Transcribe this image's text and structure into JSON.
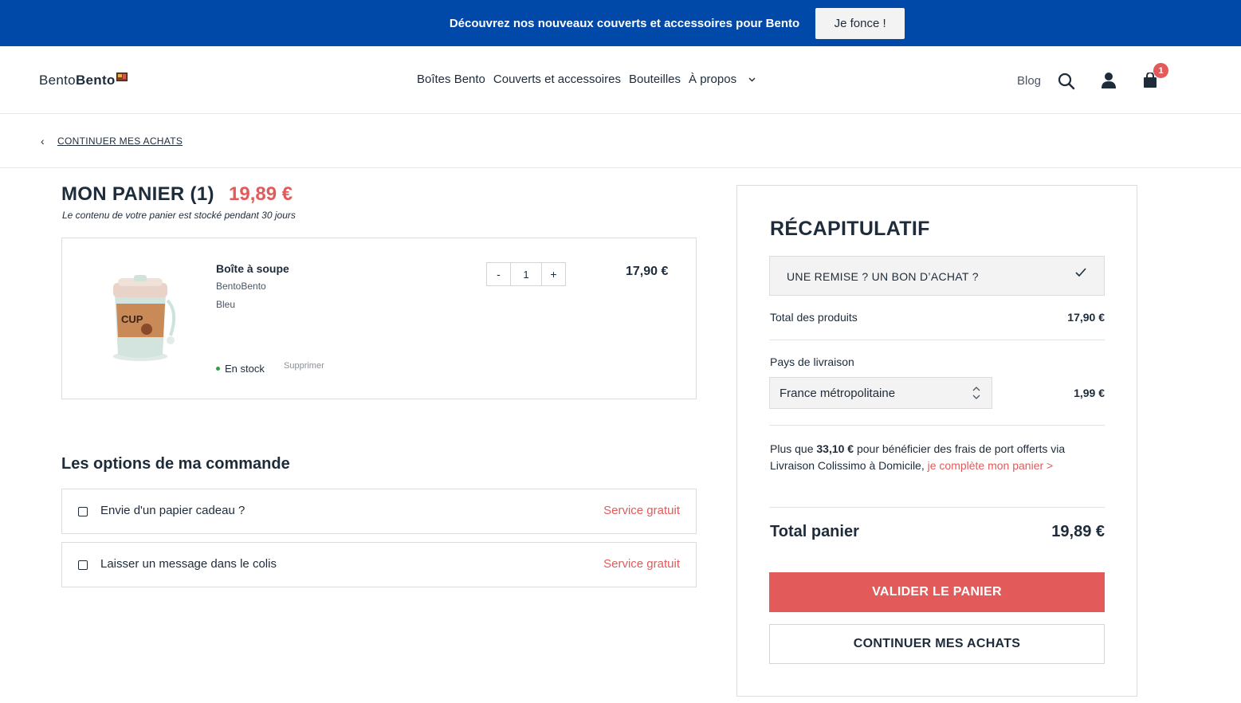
{
  "promo_bar": {
    "text": "Découvrez nos nouveaux couverts et accessoires pour Bento",
    "button_label": "Je fonce !",
    "color": "#0049a8"
  },
  "header": {
    "logo_light": "Bento",
    "logo_bold": "Bento",
    "nav": [
      {
        "label": "Boîtes Bento"
      },
      {
        "label": "Couverts et accessoires"
      },
      {
        "label": "Bouteilles"
      },
      {
        "label": "À propos"
      }
    ],
    "blog_label": "Blog",
    "icons": [
      "search-icon",
      "user-icon",
      "shopping-bag-icon"
    ],
    "cart_count": "1"
  },
  "breadcrumb": {
    "back_label": "CONTINUER MES ACHATS",
    "chevron": "‹"
  },
  "cart": {
    "title": "MON PANIER (1)",
    "total": "19,89 €",
    "note": "Le contenu de votre panier est stocké pendant 30 jours",
    "items": [
      {
        "name": "Boîte à soupe",
        "brand": "BentoBento",
        "color": "Bleu",
        "stock": "En stock",
        "remove_label": "Supprimer",
        "qty_minus": "-",
        "quantity": "1",
        "qty_plus": "+",
        "price": "17,90 €"
      }
    ]
  },
  "options": {
    "title": "Les options de ma commande",
    "items": [
      {
        "label": "Envie d'un papier cadeau ?",
        "tag": "Service gratuit"
      },
      {
        "label": "Laisser un message dans le colis",
        "tag": "Service gratuit"
      }
    ]
  },
  "summary": {
    "title": "RÉCAPITULATIF",
    "promo_code_label": "UNE REMISE ? UN BON D’ACHAT ?",
    "products_total_label": "Total des produits",
    "products_total_value": "17,90 €",
    "country_label": "Pays de livraison",
    "country_value": "France métropolitaine",
    "shipping_value": "1,99 €",
    "shipping_note_prefix": "Plus que ",
    "shipping_note_amount": "33,10 €",
    "shipping_note_middle": " pour bénéficier des frais de port offerts via Livraison Colissimo à Domicile, ",
    "shipping_note_link": "je complète mon panier >",
    "total_label": "Total panier",
    "total_value": "19,89 €",
    "validate_label": "VALIDER LE PANIER",
    "continue_label": "CONTINUER MES ACHATS"
  },
  "colors": {
    "accent": "#e25a5a",
    "text": "#1d2b3a",
    "in_stock": "#2aa34a"
  }
}
